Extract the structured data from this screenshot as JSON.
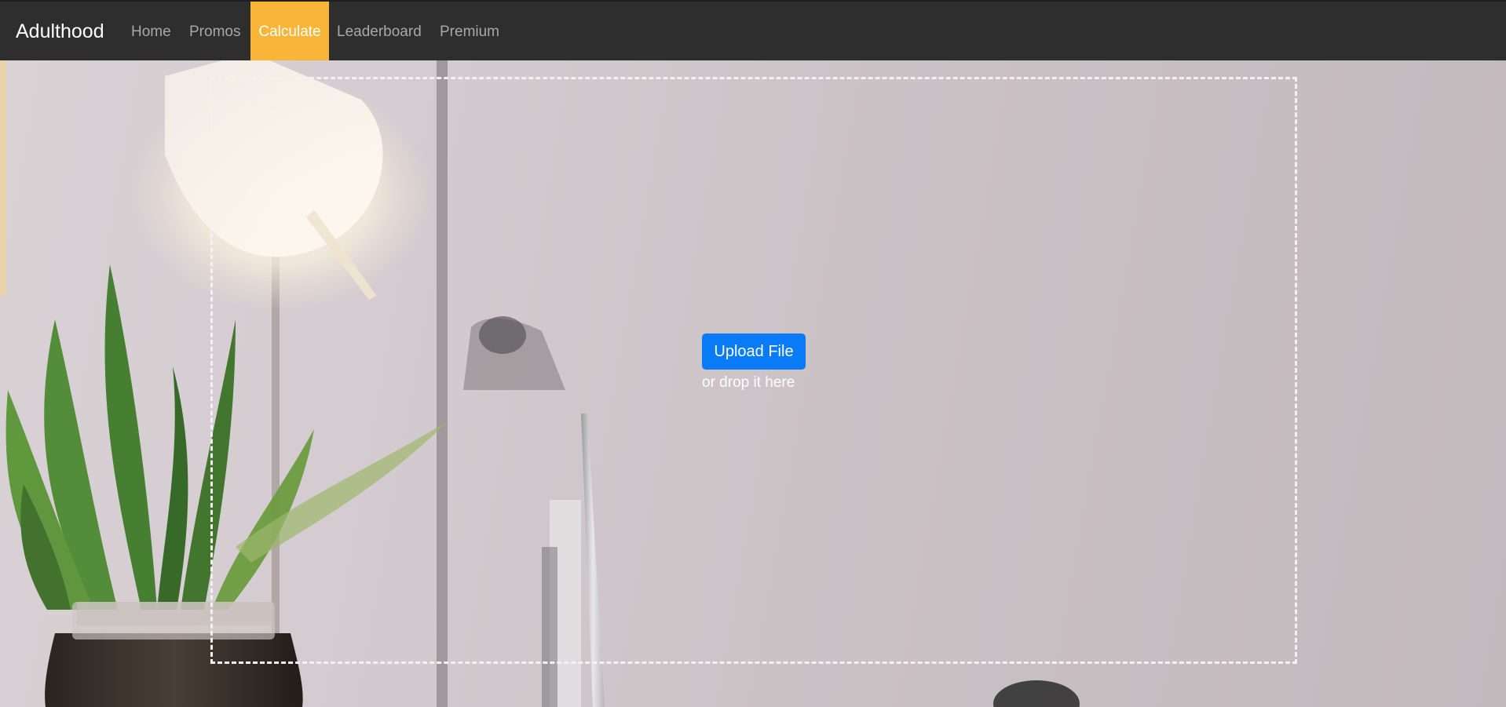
{
  "navbar": {
    "brand": "Adulthood",
    "items": [
      {
        "label": "Home",
        "active": false
      },
      {
        "label": "Promos",
        "active": false
      },
      {
        "label": "Calculate",
        "active": true
      },
      {
        "label": "Leaderboard",
        "active": false
      },
      {
        "label": "Premium",
        "active": false
      }
    ],
    "background_color": "#2e2e2e",
    "active_color": "#f8b538"
  },
  "upload": {
    "button_label": "Upload File",
    "hint": "or drop it here",
    "button_color": "#0a7bf6"
  },
  "background": {
    "description_icons": [
      "desk-lamp-icon",
      "plant-icon",
      "laptop-icon"
    ]
  }
}
